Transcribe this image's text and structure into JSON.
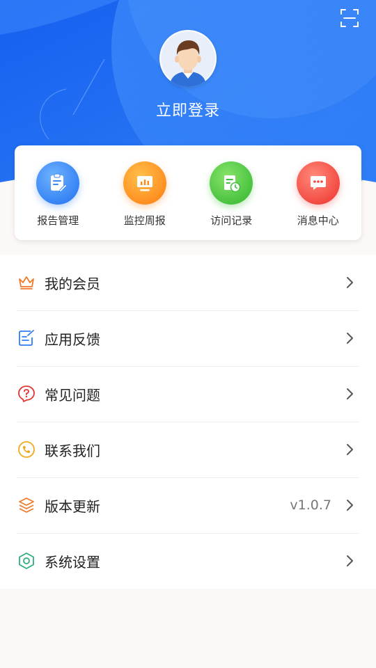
{
  "header": {
    "login_text": "立即登录",
    "colors": {
      "gradient_start": "#1a66f0",
      "gradient_end": "#3d8cff"
    }
  },
  "quick_actions": [
    {
      "label": "报告管理",
      "icon": "clipboard-edit-icon",
      "color": "#2f7df5"
    },
    {
      "label": "监控周报",
      "icon": "monitor-chart-icon",
      "color": "#ff8a1c"
    },
    {
      "label": "访问记录",
      "icon": "document-history-icon",
      "color": "#3fbf3a"
    },
    {
      "label": "消息中心",
      "icon": "chat-bubble-icon",
      "color": "#f2463e"
    }
  ],
  "menu": [
    {
      "label": "我的会员",
      "icon": "crown-icon",
      "value": ""
    },
    {
      "label": "应用反馈",
      "icon": "edit-note-icon",
      "value": ""
    },
    {
      "label": "常见问题",
      "icon": "question-bubble-icon",
      "value": ""
    },
    {
      "label": "联系我们",
      "icon": "phone-icon",
      "value": ""
    },
    {
      "label": "版本更新",
      "icon": "layers-icon",
      "value": "v1.0.7"
    },
    {
      "label": "系统设置",
      "icon": "settings-hexagon-icon",
      "value": ""
    }
  ]
}
